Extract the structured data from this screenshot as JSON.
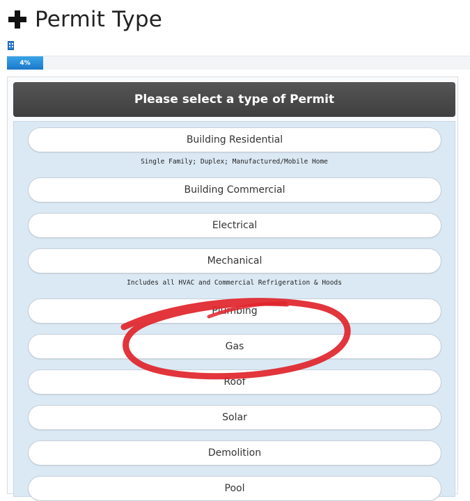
{
  "page": {
    "title": "Permit Type",
    "progress_label": "4%",
    "progress_value": 0.04
  },
  "panel": {
    "header": "Please select a type of Permit"
  },
  "options": [
    {
      "label": "Building Residential",
      "note": "Single Family; Duplex; Manufactured/Mobile Home"
    },
    {
      "label": "Building Commercial"
    },
    {
      "label": "Electrical"
    },
    {
      "label": "Mechanical",
      "note": "Includes all HVAC and Commercial Refrigeration & Hoods"
    },
    {
      "label": "Plumbing"
    },
    {
      "label": "Gas"
    },
    {
      "label": "Roof"
    },
    {
      "label": "Solar"
    },
    {
      "label": "Demolition"
    },
    {
      "label": "Pool"
    }
  ],
  "colors": {
    "header_bg": "#454545",
    "list_bg": "#dbe9f4",
    "progress": "#2a8ad8",
    "annotation": "#e0242b"
  },
  "icons": {
    "title": "plus-icon",
    "progress": "building-icon"
  }
}
